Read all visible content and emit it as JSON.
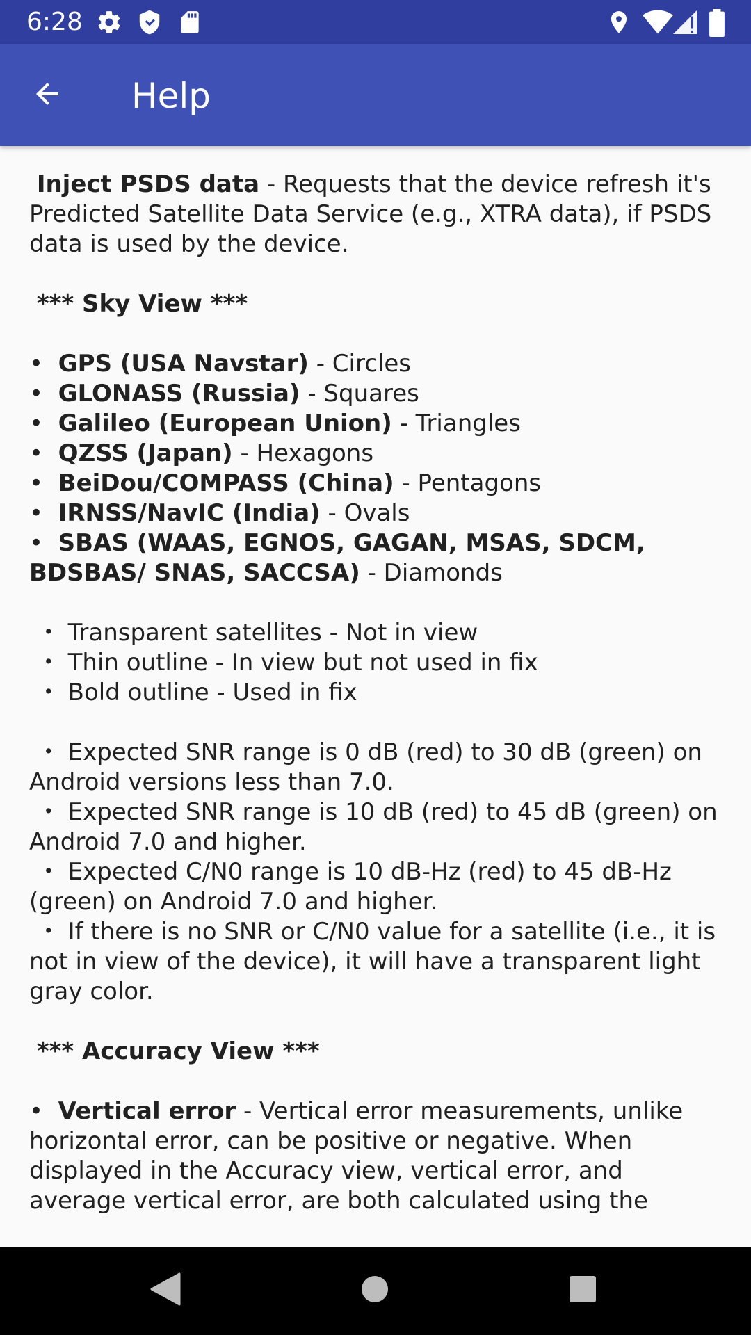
{
  "status_bar": {
    "time": "6:28",
    "left_icons": [
      "settings-icon",
      "shield-icon",
      "sd-card-icon"
    ],
    "right_icons": [
      "location-icon",
      "wifi-icon",
      "cell-signal-icon",
      "battery-icon"
    ],
    "color": "#303f9f"
  },
  "app_bar": {
    "title": "Help",
    "color": "#3f51b5"
  },
  "content": {
    "inject": {
      "title": "Inject PSDS data",
      "text": " - Requests that the device refresh it's Predicted Satellite Data Service (e.g., XTRA data), if PSDS data is used by the device."
    },
    "sky_view_heading": "*** Sky View ***",
    "constellations": [
      {
        "name": "GPS (USA Navstar)",
        "shape": " - Circles"
      },
      {
        "name": "GLONASS (Russia)",
        "shape": " - Squares"
      },
      {
        "name": "Galileo (European Union)",
        "shape": " - Triangles"
      },
      {
        "name": "QZSS (Japan)",
        "shape": " - Hexagons"
      },
      {
        "name": "BeiDou/COMPASS (China)",
        "shape": " - Pentagons"
      },
      {
        "name": "IRNSS/NavIC (India)",
        "shape": " - Ovals"
      },
      {
        "name": "SBAS (WAAS, EGNOS, GAGAN, MSAS, SDCM, BDSBAS/ SNAS, SACCSA)",
        "shape": " - Diamonds"
      }
    ],
    "satellite_states": [
      "Transparent satellites - Not in view",
      "Thin outline - In view but not used in fix",
      "Bold outline - Used in fix"
    ],
    "snr_notes": [
      "Expected SNR range is 0 dB (red) to 30 dB (green) on Android versions less than 7.0.",
      "Expected SNR range is 10 dB (red) to 45 dB (green) on Android 7.0 and higher.",
      "Expected C/N0 range is 10 dB-Hz (red) to 45 dB-Hz (green) on Android 7.0 and higher.",
      "If there is no SNR or C/N0 value for a satellite (i.e., it is not in view of the device), it will have a transparent light gray color."
    ],
    "accuracy_view_heading": "*** Accuracy View ***",
    "vertical_error": {
      "title": "Vertical error",
      "text": " - Vertical error measurements, unlike horizontal error, can be positive or negative. When displayed in the Accuracy view, vertical error, and average vertical error, are both calculated using the absolute value of the"
    }
  },
  "nav_bar": {
    "buttons": [
      "back-triangle-icon",
      "home-circle-icon",
      "recents-square-icon"
    ]
  }
}
